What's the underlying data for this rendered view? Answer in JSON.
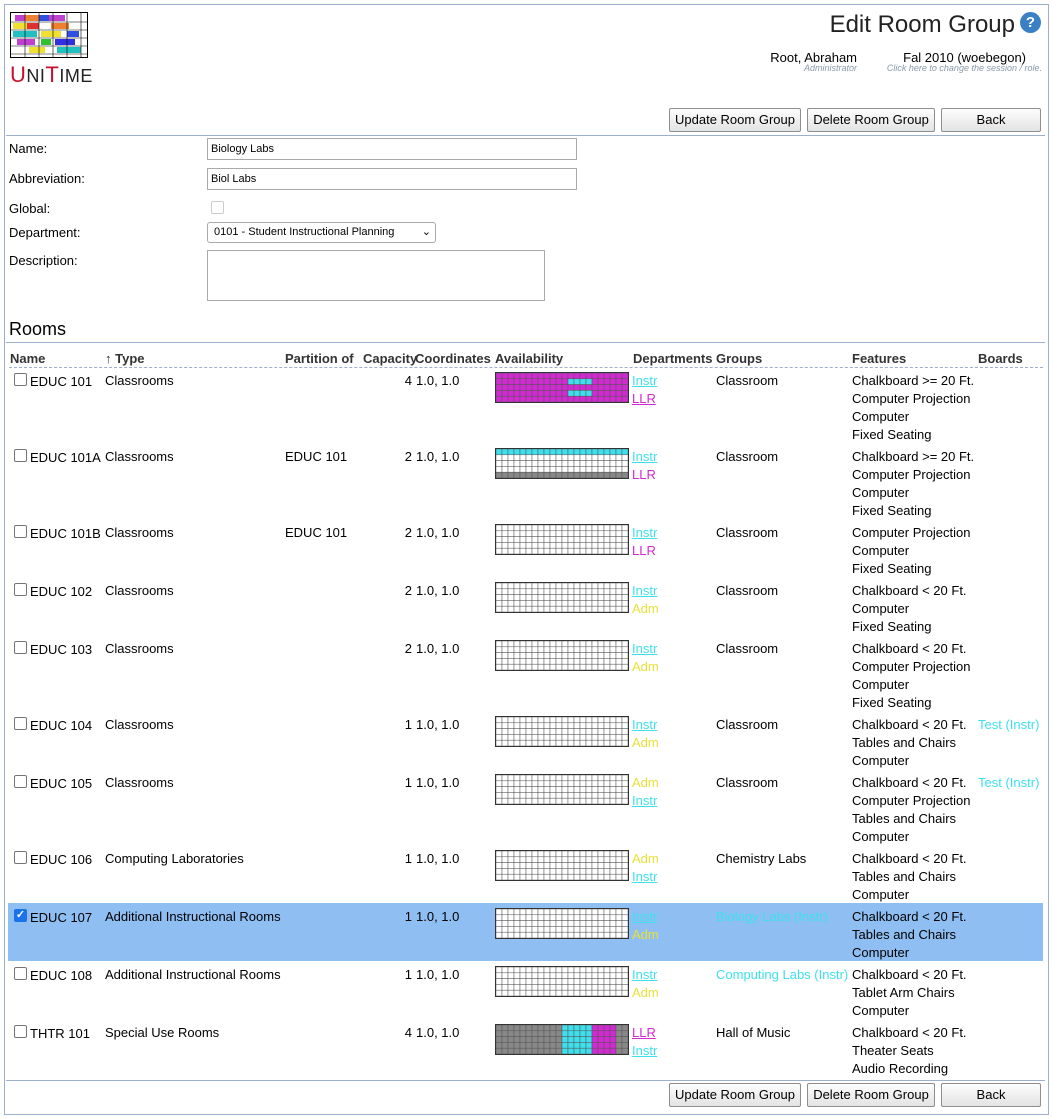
{
  "header": {
    "logo_text": "UniTime",
    "title": "Edit Room Group",
    "help_icon": "help-icon",
    "user_name": "Root, Abraham",
    "user_role": "Administrator",
    "session": "Fal 2010 (woebegon)",
    "session_hint": "Click here to change the session / role."
  },
  "buttons": {
    "update": "Update Room Group",
    "delete": "Delete Room Group",
    "back": "Back"
  },
  "form": {
    "name_label": "Name:",
    "name_value": "Biology Labs",
    "abbreviation_label": "Abbreviation:",
    "abbreviation_value": "Biol Labs",
    "global_label": "Global:",
    "global_checked": false,
    "department_label": "Department:",
    "department_value": "0101 - Student Instructional Planning",
    "description_label": "Description:",
    "description_value": ""
  },
  "rooms": {
    "heading": "Rooms",
    "columns": {
      "name": "Name",
      "type": "↑ Type",
      "partition": "Partition of",
      "capacity": "Capacity",
      "coordinates": "Coordinates",
      "availability": "Availability",
      "departments": "Departments",
      "groups": "Groups",
      "features": "Features",
      "boards": "Boards"
    },
    "rows": [
      {
        "name": "EDUC 101",
        "type": "Classrooms",
        "partition": "",
        "capacity": "4",
        "coordinates": "1.0, 1.0",
        "departments": [
          "Instr",
          "LLR"
        ],
        "groups": "Classroom",
        "group_color": "#000000",
        "features": [
          "Chalkboard >= 20 Ft.",
          "Computer Projection",
          "Computer",
          "Fixed Seating"
        ],
        "boards": "",
        "checked": false
      },
      {
        "name": "EDUC 101A",
        "type": "Classrooms",
        "partition": "EDUC 101",
        "capacity": "2",
        "coordinates": "1.0, 1.0",
        "departments": [
          "Instr",
          "LLR"
        ],
        "groups": "Classroom",
        "group_color": "#000000",
        "features": [
          "Chalkboard >= 20 Ft.",
          "Computer Projection",
          "Computer",
          "Fixed Seating"
        ],
        "boards": "",
        "checked": false
      },
      {
        "name": "EDUC 101B",
        "type": "Classrooms",
        "partition": "EDUC 101",
        "capacity": "2",
        "coordinates": "1.0, 1.0",
        "departments": [
          "Instr",
          "LLR"
        ],
        "groups": "Classroom",
        "group_color": "#000000",
        "features": [
          "Computer Projection",
          "Computer",
          "Fixed Seating"
        ],
        "boards": "",
        "checked": false
      },
      {
        "name": "EDUC 102",
        "type": "Classrooms",
        "partition": "",
        "capacity": "2",
        "coordinates": "1.0, 1.0",
        "departments": [
          "Instr",
          "Adm"
        ],
        "groups": "Classroom",
        "group_color": "#000000",
        "features": [
          "Chalkboard < 20 Ft.",
          "Computer",
          "Fixed Seating"
        ],
        "boards": "",
        "checked": false
      },
      {
        "name": "EDUC 103",
        "type": "Classrooms",
        "partition": "",
        "capacity": "2",
        "coordinates": "1.0, 1.0",
        "departments": [
          "Instr",
          "Adm"
        ],
        "groups": "Classroom",
        "group_color": "#000000",
        "features": [
          "Chalkboard < 20 Ft.",
          "Computer Projection",
          "Computer",
          "Fixed Seating"
        ],
        "boards": "",
        "checked": false
      },
      {
        "name": "EDUC 104",
        "type": "Classrooms",
        "partition": "",
        "capacity": "1",
        "coordinates": "1.0, 1.0",
        "departments": [
          "Instr",
          "Adm"
        ],
        "groups": "Classroom",
        "group_color": "#000000",
        "features": [
          "Chalkboard < 20 Ft.",
          "Tables and Chairs",
          "Computer"
        ],
        "boards": "Test (Instr)",
        "checked": false
      },
      {
        "name": "EDUC 105",
        "type": "Classrooms",
        "partition": "",
        "capacity": "1",
        "coordinates": "1.0, 1.0",
        "departments": [
          "Adm",
          "Instr"
        ],
        "groups": "Classroom",
        "group_color": "#000000",
        "features": [
          "Chalkboard < 20 Ft.",
          "Computer Projection",
          "Tables and Chairs",
          "Computer"
        ],
        "boards": "Test (Instr)",
        "checked": false
      },
      {
        "name": "EDUC 106",
        "type": "Computing Laboratories",
        "partition": "",
        "capacity": "1",
        "coordinates": "1.0, 1.0",
        "departments": [
          "Adm",
          "Instr"
        ],
        "groups": "Chemistry Labs",
        "group_color": "#000000",
        "features": [
          "Chalkboard < 20 Ft.",
          "Tables and Chairs",
          "Computer"
        ],
        "boards": "",
        "checked": false
      },
      {
        "name": "EDUC 107",
        "type": "Additional Instructional Rooms",
        "partition": "",
        "capacity": "1",
        "coordinates": "1.0, 1.0",
        "departments": [
          "Instr",
          "Adm"
        ],
        "groups": "Biology Labs (Instr)",
        "group_color": "#3ee0ee",
        "features": [
          "Chalkboard < 20 Ft.",
          "Tables and Chairs",
          "Computer"
        ],
        "boards": "",
        "checked": true
      },
      {
        "name": "EDUC 108",
        "type": "Additional Instructional Rooms",
        "partition": "",
        "capacity": "1",
        "coordinates": "1.0, 1.0",
        "departments": [
          "Instr",
          "Adm"
        ],
        "groups": "Computing Labs (Instr)",
        "group_color": "#3ee0ee",
        "features": [
          "Chalkboard < 20 Ft.",
          "Tablet Arm Chairs",
          "Computer"
        ],
        "boards": "",
        "checked": false
      },
      {
        "name": "THTR 101",
        "type": "Special Use Rooms",
        "partition": "",
        "capacity": "4",
        "coordinates": "1.0, 1.0",
        "departments": [
          "LLR",
          "Instr"
        ],
        "groups": "Hall of Music",
        "group_color": "#000000",
        "features": [
          "Chalkboard < 20 Ft.",
          "Theater Seats",
          "Audio Recording"
        ],
        "boards": "",
        "checked": false
      }
    ]
  },
  "colors": {
    "instr": "#3ee0ee",
    "llr": "#d22ad2",
    "adm": "#e8e03a",
    "selected_row": "#8fbef2",
    "border": "#9cb0ce"
  }
}
